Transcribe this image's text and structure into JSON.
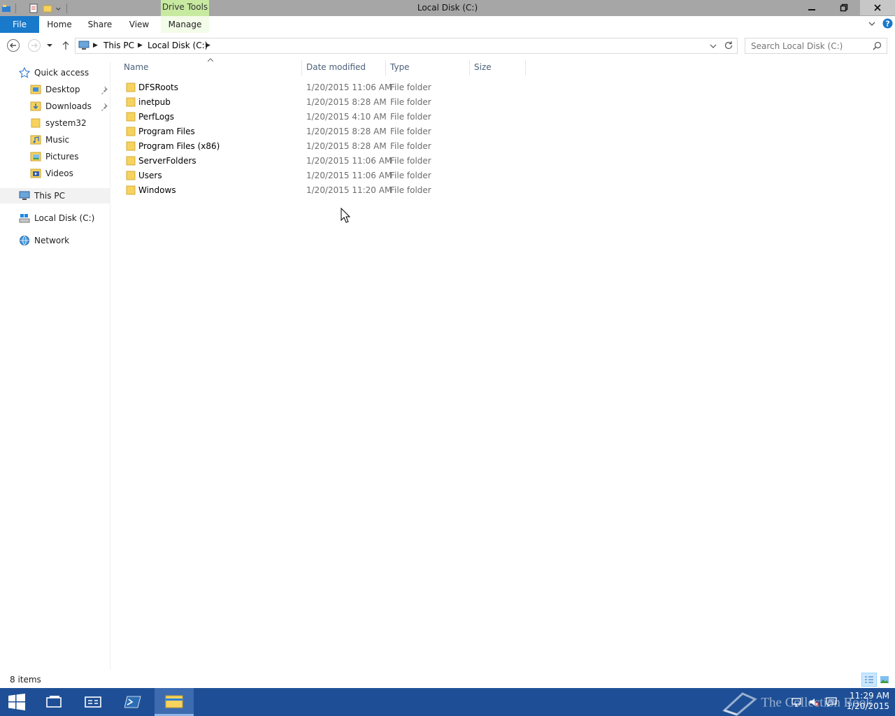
{
  "window": {
    "title": "Local Disk (C:)",
    "context_tab": "Drive Tools"
  },
  "ribbon": {
    "tabs": [
      {
        "label": "File"
      },
      {
        "label": "Home"
      },
      {
        "label": "Share"
      },
      {
        "label": "View"
      },
      {
        "label": "Manage"
      }
    ]
  },
  "address": {
    "crumbs": [
      "This PC",
      "Local Disk (C:)"
    ]
  },
  "search": {
    "placeholder": "Search Local Disk (C:)"
  },
  "navpane": {
    "quick_access": "Quick access",
    "items": [
      {
        "label": "Desktop",
        "icon": "desktop-folder-icon",
        "pinned": true
      },
      {
        "label": "Downloads",
        "icon": "downloads-folder-icon",
        "pinned": true
      },
      {
        "label": "system32",
        "icon": "folder-icon",
        "pinned": false
      },
      {
        "label": "Music",
        "icon": "music-folder-icon",
        "pinned": false
      },
      {
        "label": "Pictures",
        "icon": "pictures-folder-icon",
        "pinned": false
      },
      {
        "label": "Videos",
        "icon": "videos-folder-icon",
        "pinned": false
      }
    ],
    "this_pc": "This PC",
    "local_disk": "Local Disk (C:)",
    "network": "Network"
  },
  "columns": {
    "name": "Name",
    "date": "Date modified",
    "type": "Type",
    "size": "Size"
  },
  "files": [
    {
      "name": "DFSRoots",
      "date": "1/20/2015 11:06 AM",
      "type": "File folder"
    },
    {
      "name": "inetpub",
      "date": "1/20/2015 8:28 AM",
      "type": "File folder"
    },
    {
      "name": "PerfLogs",
      "date": "1/20/2015 4:10 AM",
      "type": "File folder"
    },
    {
      "name": "Program Files",
      "date": "1/20/2015 8:28 AM",
      "type": "File folder"
    },
    {
      "name": "Program Files (x86)",
      "date": "1/20/2015 8:28 AM",
      "type": "File folder"
    },
    {
      "name": "ServerFolders",
      "date": "1/20/2015 11:06 AM",
      "type": "File folder"
    },
    {
      "name": "Users",
      "date": "1/20/2015 11:06 AM",
      "type": "File folder"
    },
    {
      "name": "Windows",
      "date": "1/20/2015 11:20 AM",
      "type": "File folder"
    }
  ],
  "status": {
    "item_count": "8 items"
  },
  "taskbar": {
    "time": "11:29 AM",
    "date": "1/20/2015",
    "watermark": "The Collection Book"
  },
  "colors": {
    "file_tab": "#1979ca",
    "drive_tools": "#c7eaa0",
    "taskbar": "#1e4f96",
    "folder": "#f6d25e"
  }
}
